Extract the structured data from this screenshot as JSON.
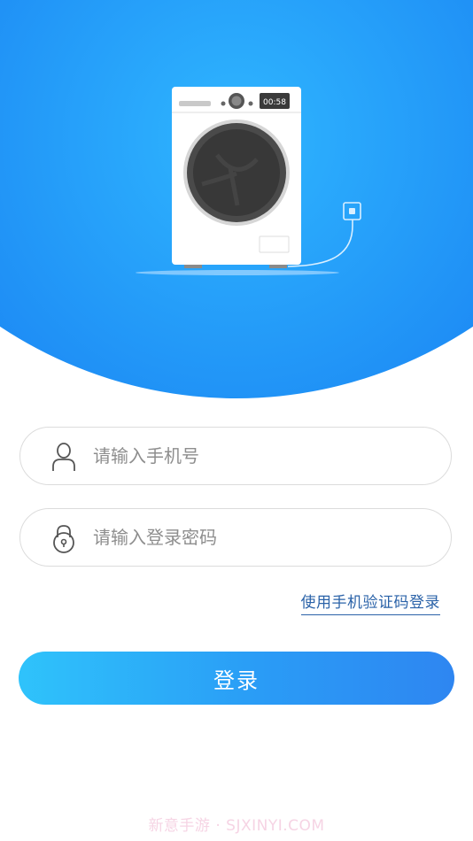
{
  "hero": {
    "timer_display": "00:58",
    "illustration": "washing-machine"
  },
  "login_form": {
    "phone_placeholder": "请输入手机号",
    "password_placeholder": "请输入登录密码",
    "phone_icon": "user-icon",
    "password_icon": "lock-icon",
    "sms_login_link": "使用手机验证码登录",
    "login_button": "登录"
  },
  "watermark": {
    "text": "新意手游 · SJXINYI.COM"
  },
  "colors": {
    "accent": "#2f8cf2",
    "button_gradient_start": "#2fc3fb",
    "button_gradient_end": "#2e86f1",
    "link": "#2a62a8"
  }
}
